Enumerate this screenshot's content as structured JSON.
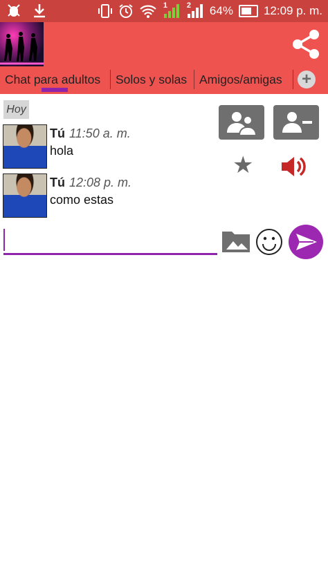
{
  "status_bar": {
    "battery_percent": "64%",
    "time": "12:09 p. m.",
    "sim1_label": "1",
    "sim2_label": "2",
    "icons": [
      "bug-icon",
      "download-icon",
      "vibrate-icon",
      "alarm-icon",
      "wifi-icon",
      "signal-icon",
      "signal-icon",
      "battery-icon"
    ]
  },
  "tabs": [
    {
      "label": "Chat para adultos",
      "active": true
    },
    {
      "label": "Solos y solas"
    },
    {
      "label": "Amigos/amigas"
    }
  ],
  "add_tab_label": "+",
  "chat": {
    "date_label": "Hoy",
    "messages": [
      {
        "sender": "Tú",
        "time": "11:50 a. m.",
        "text": "hola"
      },
      {
        "sender": "Tú",
        "time": "12:08 p. m.",
        "text": "como estas"
      }
    ]
  },
  "composer": {
    "value": "",
    "placeholder": ""
  },
  "colors": {
    "status_bar": "#c9423e",
    "app_bar": "#ef5350",
    "accent": "#8e24aa",
    "send_button": "#9c27b0",
    "speaker": "#c62828",
    "tool_button": "#6f6f6f"
  }
}
